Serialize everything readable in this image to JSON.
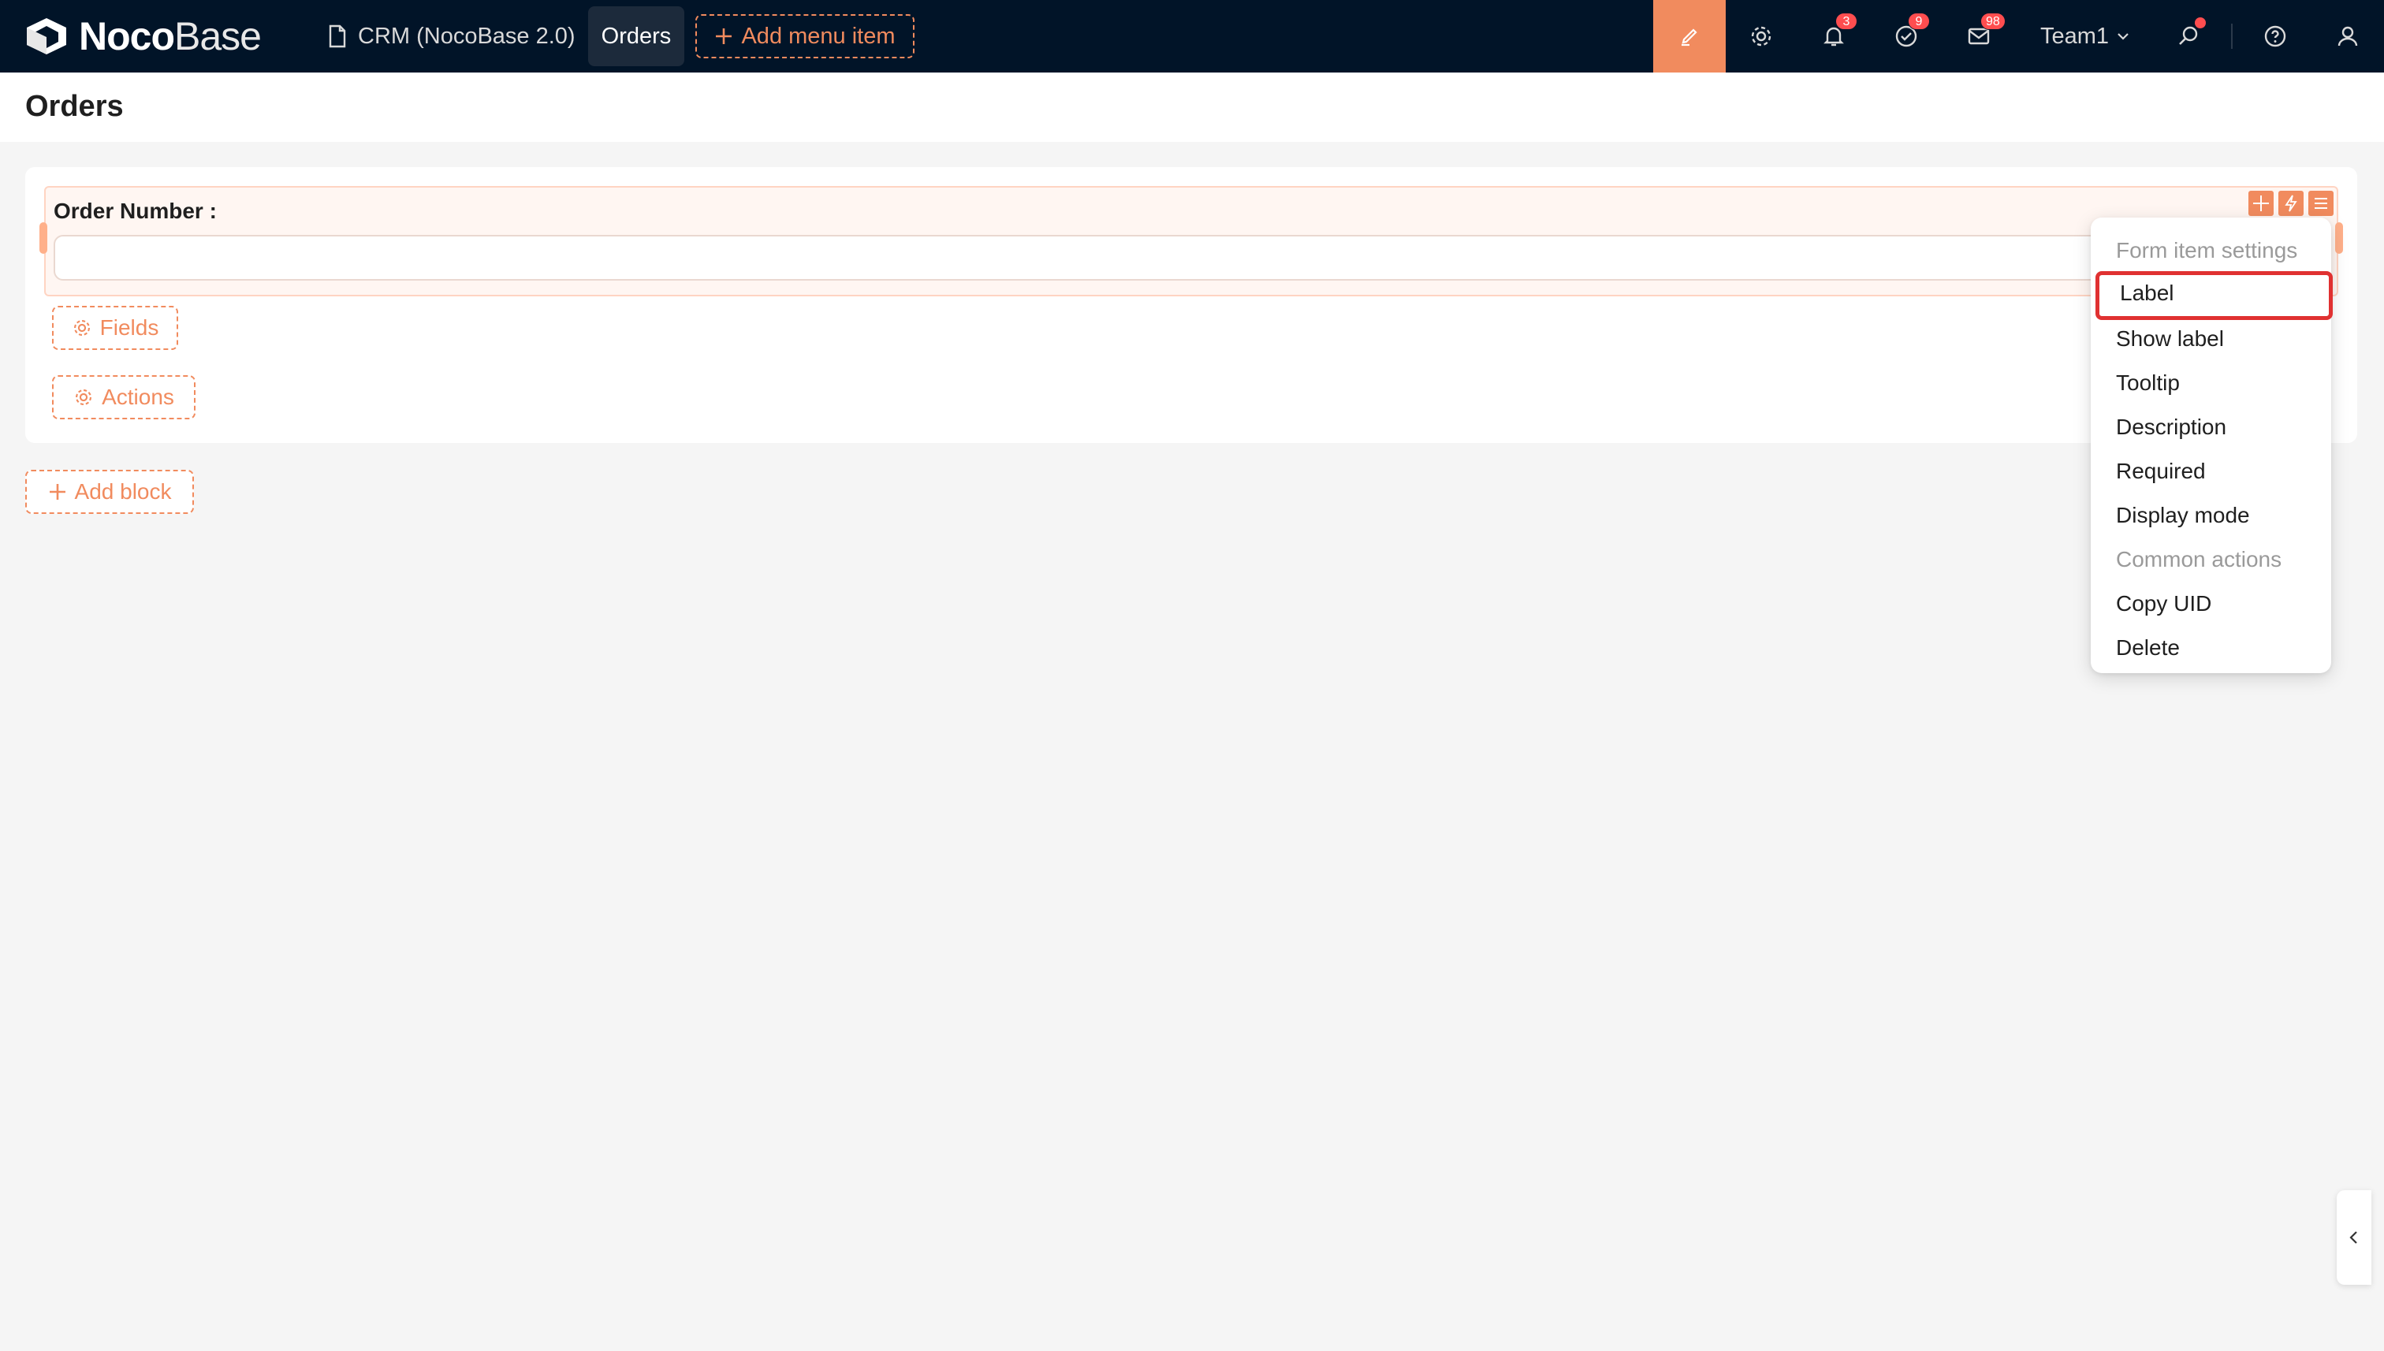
{
  "app": {
    "logo_bold": "Noco",
    "logo_light": "Base"
  },
  "nav": {
    "items": [
      {
        "label": "CRM (NocoBase 2.0)",
        "icon": "document-icon"
      },
      {
        "label": "Orders"
      }
    ],
    "add_menu_label": "Add menu item"
  },
  "toolbar": {
    "notifications_count": "3",
    "tasks_count": "9",
    "messages_count": "98",
    "role": "Team1"
  },
  "page": {
    "title": "Orders"
  },
  "form": {
    "field_label": "Order Number :",
    "field_value": "",
    "fields_button": "Fields",
    "actions_button": "Actions"
  },
  "add_block_label": "Add block",
  "dropdown": {
    "group1": "Form item settings",
    "items1": [
      "Label",
      "Show label",
      "Tooltip",
      "Description",
      "Required",
      "Display mode"
    ],
    "group2": "Common actions",
    "items2": [
      "Copy UID",
      "Delete"
    ]
  },
  "colors": {
    "topbar": "#011428",
    "accent": "#f18b5e",
    "highlight_border": "#e03131"
  }
}
